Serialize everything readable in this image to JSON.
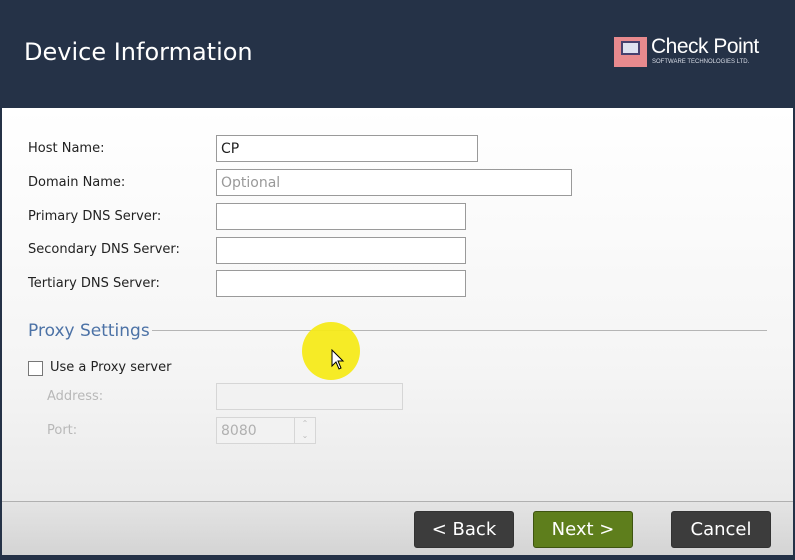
{
  "header": {
    "title": "Device Information",
    "logo_name": "Check Point",
    "logo_sub": "SOFTWARE TECHNOLOGIES LTD."
  },
  "form": {
    "host_name": {
      "label": "Host Name:",
      "value": "CP"
    },
    "domain_name": {
      "label": "Domain Name:",
      "value": "",
      "placeholder": "Optional"
    },
    "primary_dns": {
      "label": "Primary DNS Server:",
      "value": ""
    },
    "secondary_dns": {
      "label": "Secondary DNS Server:",
      "value": ""
    },
    "tertiary_dns": {
      "label": "Tertiary DNS Server:",
      "value": ""
    }
  },
  "proxy": {
    "section_title": "Proxy Settings",
    "use_proxy_label": "Use a Proxy server",
    "use_proxy_checked": false,
    "address": {
      "label": "Address:",
      "value": ""
    },
    "port": {
      "label": "Port:",
      "value": "8080"
    }
  },
  "footer": {
    "back": "< Back",
    "next": "Next >",
    "cancel": "Cancel"
  },
  "colors": {
    "header_bg": "#253247",
    "section": "#4c72a6",
    "next_button": "#5e7e1c",
    "cursor_highlight": "#f6ea1a"
  }
}
